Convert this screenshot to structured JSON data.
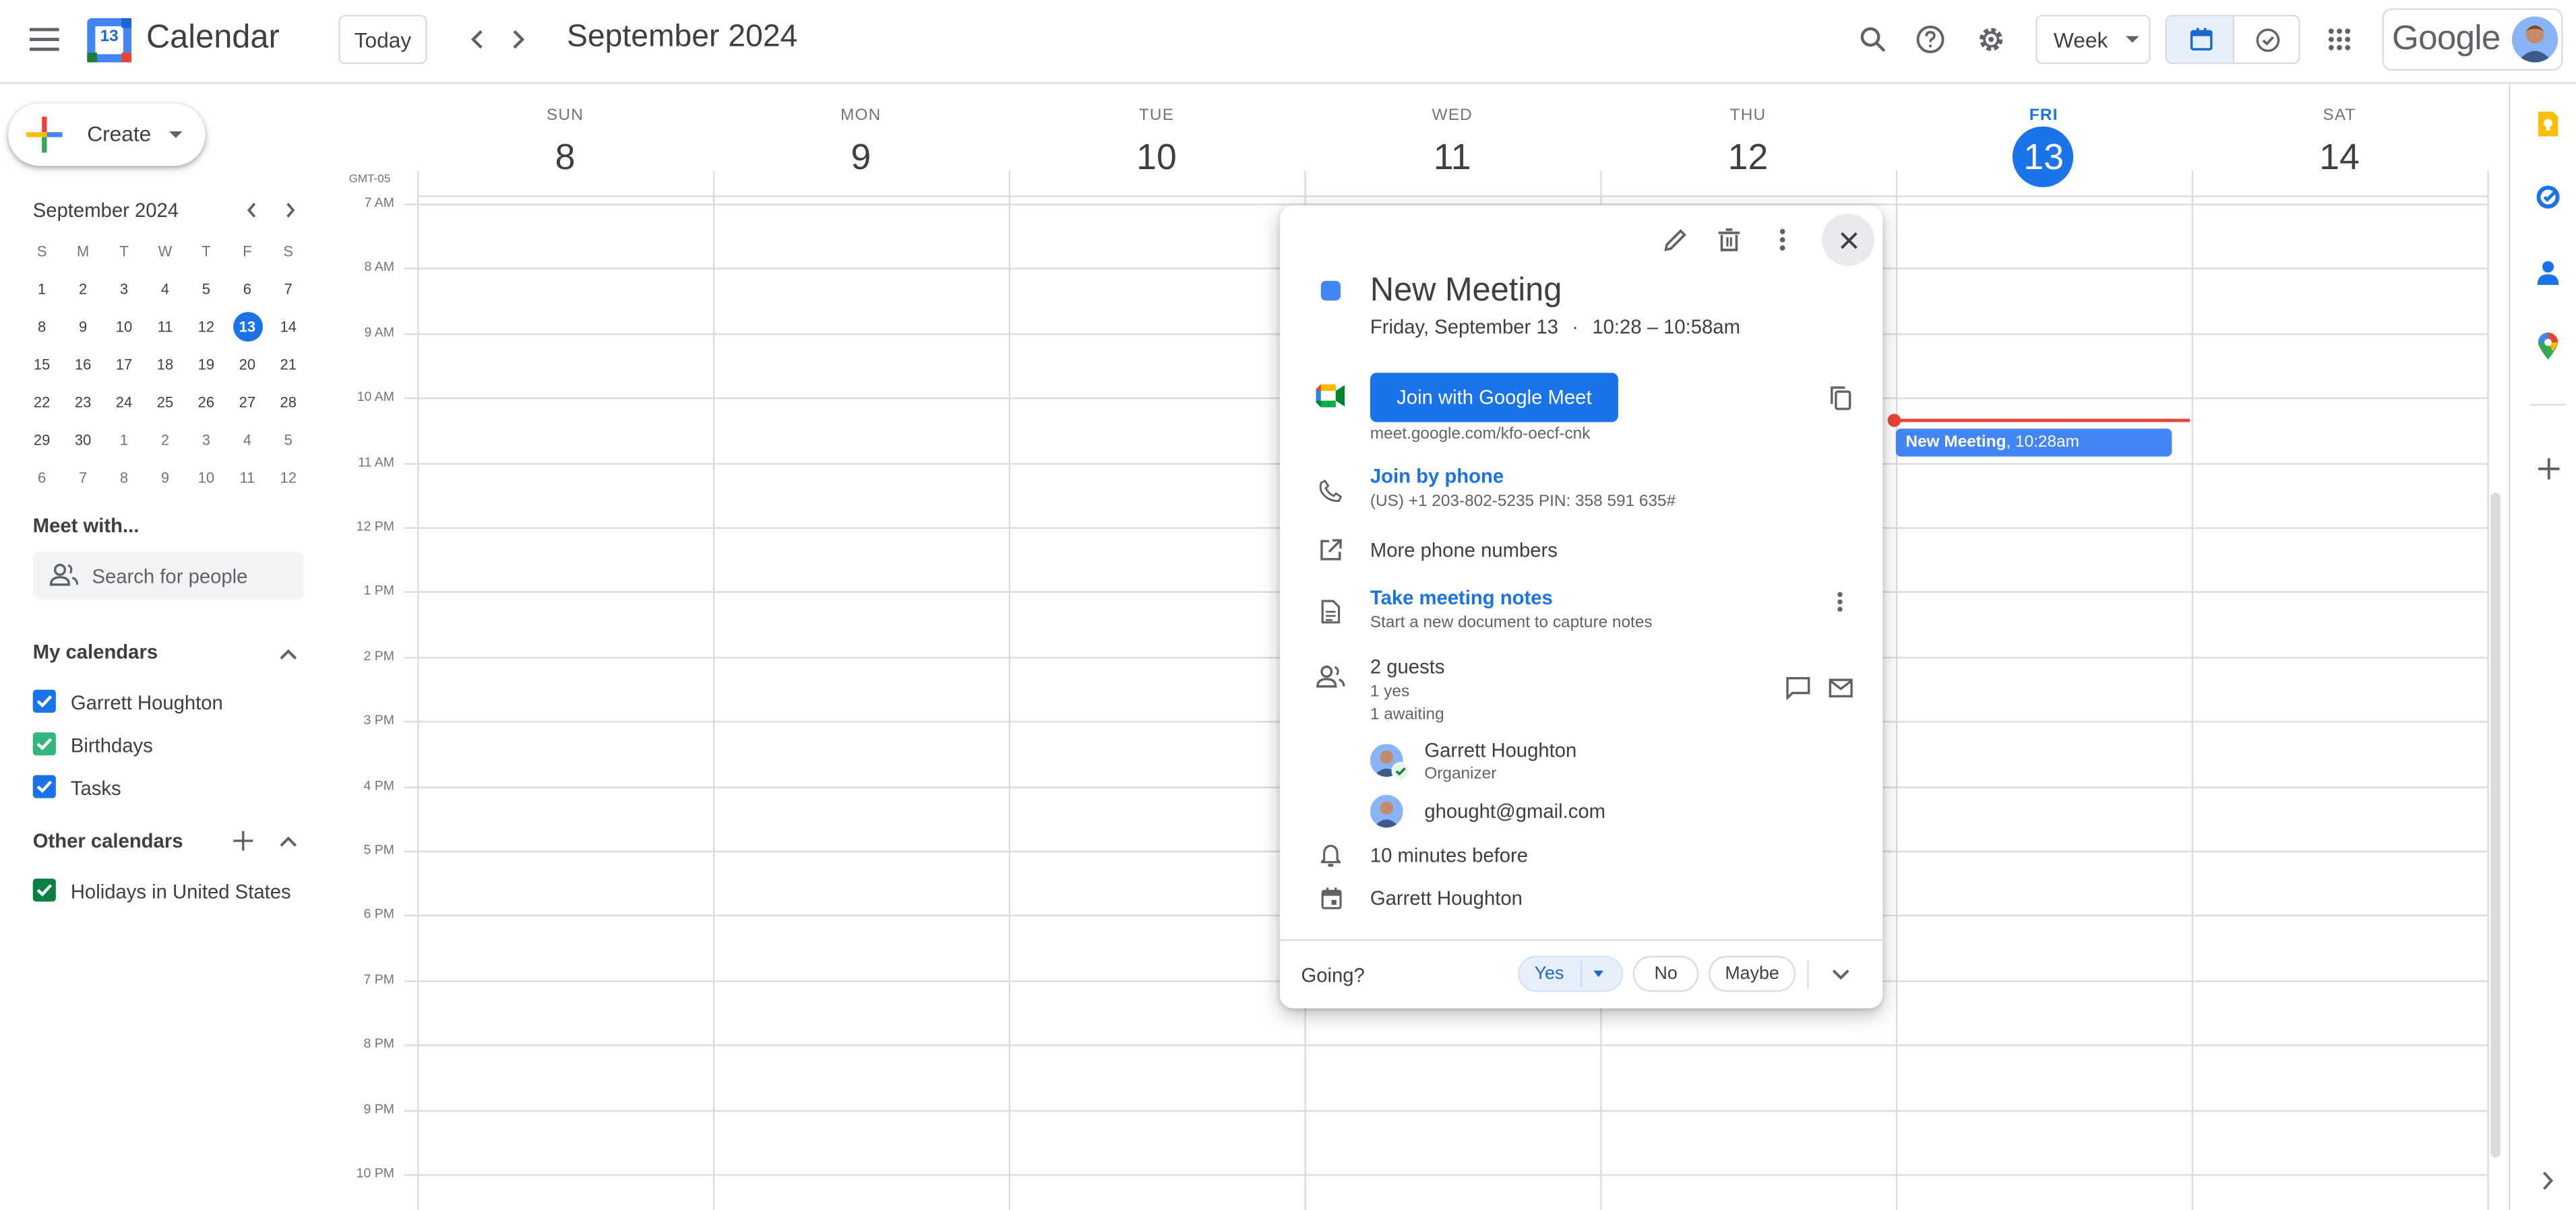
{
  "header": {
    "app_name": "Calendar",
    "app_logo_number": "13",
    "today_label": "Today",
    "current_period": "September 2024",
    "view_select": "Week",
    "google_logo": "Google"
  },
  "sidebar": {
    "create_label": "Create",
    "mini_calendar": {
      "title": "September 2024",
      "weekday_headers": [
        "S",
        "M",
        "T",
        "W",
        "T",
        "F",
        "S"
      ],
      "weeks": [
        [
          "1",
          "2",
          "3",
          "4",
          "5",
          "6",
          "7"
        ],
        [
          "8",
          "9",
          "10",
          "11",
          "12",
          "13",
          "14"
        ],
        [
          "15",
          "16",
          "17",
          "18",
          "19",
          "20",
          "21"
        ],
        [
          "22",
          "23",
          "24",
          "25",
          "26",
          "27",
          "28"
        ],
        [
          "29",
          "30",
          "1",
          "2",
          "3",
          "4",
          "5"
        ],
        [
          "6",
          "7",
          "8",
          "9",
          "10",
          "11",
          "12"
        ]
      ],
      "selected": "13"
    },
    "meet_with_heading": "Meet with...",
    "search_people_placeholder": "Search for people",
    "my_calendars_heading": "My calendars",
    "my_calendars": [
      {
        "label": "Garrett Houghton",
        "color": "#1a73e8"
      },
      {
        "label": "Birthdays",
        "color": "#33b679"
      },
      {
        "label": "Tasks",
        "color": "#1a73e8"
      }
    ],
    "other_calendars_heading": "Other calendars",
    "other_calendars": [
      {
        "label": "Holidays in United States",
        "color": "#0b8043"
      }
    ]
  },
  "week": {
    "timezone": "GMT-05",
    "days": [
      {
        "dow": "SUN",
        "num": "8"
      },
      {
        "dow": "MON",
        "num": "9"
      },
      {
        "dow": "TUE",
        "num": "10"
      },
      {
        "dow": "WED",
        "num": "11"
      },
      {
        "dow": "THU",
        "num": "12"
      },
      {
        "dow": "FRI",
        "num": "13",
        "today": true
      },
      {
        "dow": "SAT",
        "num": "14"
      }
    ],
    "hours": [
      "7 AM",
      "8 AM",
      "9 AM",
      "10 AM",
      "11 AM",
      "12 PM",
      "1 PM",
      "2 PM",
      "3 PM",
      "4 PM",
      "5 PM",
      "6 PM",
      "7 PM",
      "8 PM",
      "9 PM",
      "10 PM"
    ],
    "event_chip": {
      "title": "New Meeting",
      "time": ", 10:28am"
    }
  },
  "popup": {
    "title": "New Meeting",
    "date": "Friday, September 13",
    "separator": "·",
    "time": "10:28 – 10:58am",
    "color": "#4285f4",
    "join_button": "Join with Google Meet",
    "meet_link": "meet.google.com/kfo-oecf-cnk",
    "join_phone": "Join by phone",
    "phone_detail": "(US) +1 203-802-5235 PIN: 358 591 635#",
    "more_numbers": "More phone numbers",
    "notes_title": "Take meeting notes",
    "notes_sub": "Start a new document to capture notes",
    "guests_count": "2 guests",
    "guests_yes": "1 yes",
    "guests_awaiting": "1 awaiting",
    "guests": [
      {
        "name": "Garrett Houghton",
        "role": "Organizer"
      },
      {
        "name": "ghought@gmail.com",
        "role": ""
      }
    ],
    "reminder": "10 minutes before",
    "calendar_owner": "Garrett Houghton",
    "going_label": "Going?",
    "rsvp_yes": "Yes",
    "rsvp_no": "No",
    "rsvp_maybe": "Maybe"
  }
}
